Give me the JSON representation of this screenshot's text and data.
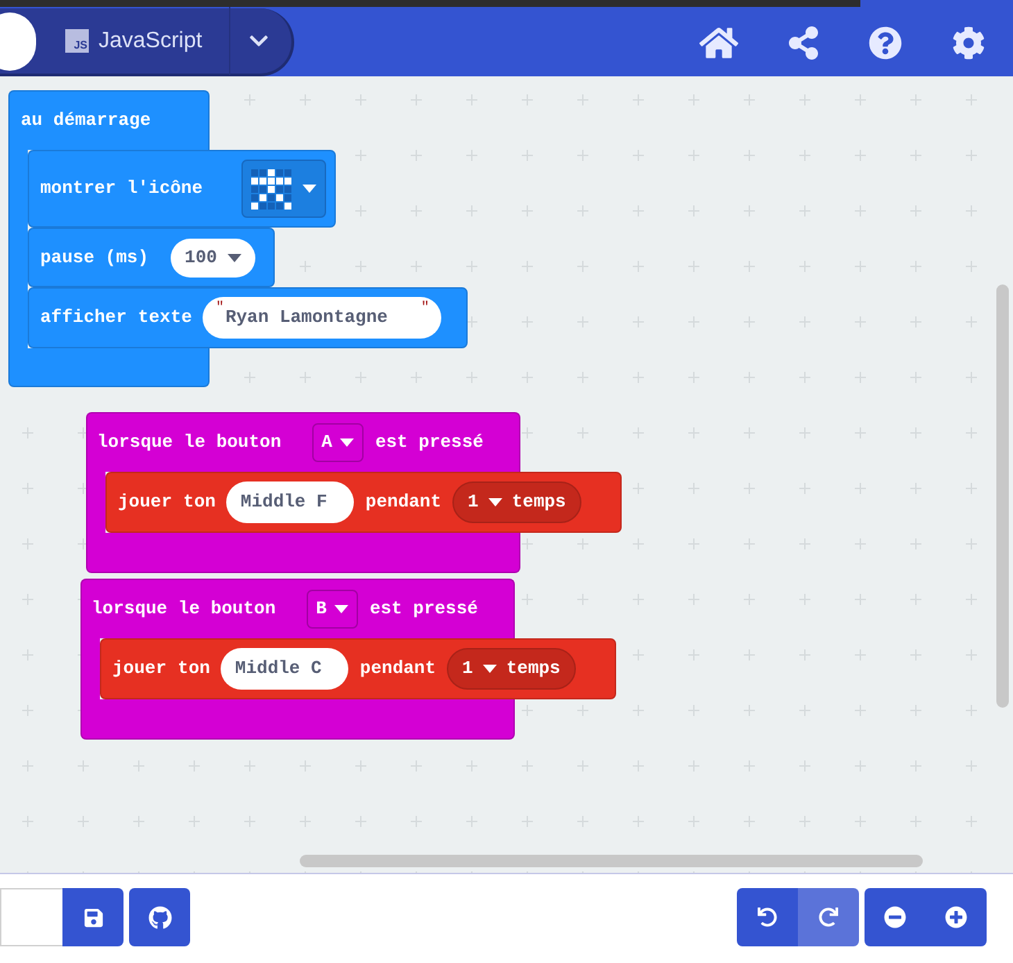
{
  "header": {
    "language_badge": "JS",
    "language": "JavaScript"
  },
  "blocks": [
    {
      "kind": "start",
      "label": "au démarrage",
      "statements": [
        {
          "kind": "show_icon",
          "label": "montrer l'icône",
          "leds": [
            [
              false,
              false,
              true,
              false,
              false
            ],
            [
              true,
              true,
              true,
              true,
              true
            ],
            [
              false,
              false,
              true,
              false,
              false
            ],
            [
              false,
              true,
              false,
              true,
              false
            ],
            [
              true,
              false,
              false,
              false,
              true
            ]
          ]
        },
        {
          "kind": "pause",
          "label": "pause (ms)",
          "value": "100"
        },
        {
          "kind": "show_string",
          "label_1": "afficher",
          "label_2": "texte",
          "open_quote": "\"",
          "value": "Ryan Lamontagne",
          "close_quote": "\""
        }
      ]
    },
    {
      "kind": "button_pressed",
      "label_1": "lorsque le bouton",
      "button": "A",
      "label_2": "est pressé",
      "statements": [
        {
          "kind": "play_tone",
          "label_1": "jouer",
          "label_2": "ton",
          "note": "Middle F",
          "label_3": "pendant",
          "beats": "1",
          "label_4": "temps"
        }
      ]
    },
    {
      "kind": "button_pressed",
      "label_1": "lorsque le bouton",
      "button": "B",
      "label_2": "est pressé",
      "statements": [
        {
          "kind": "play_tone",
          "label_1": "jouer",
          "label_2": "ton",
          "note": "Middle C",
          "label_3": "pendant",
          "beats": "1",
          "label_4": "temps"
        }
      ]
    }
  ],
  "toolbar": {
    "undo": {
      "disabled": false
    },
    "redo": {
      "disabled": true
    }
  }
}
